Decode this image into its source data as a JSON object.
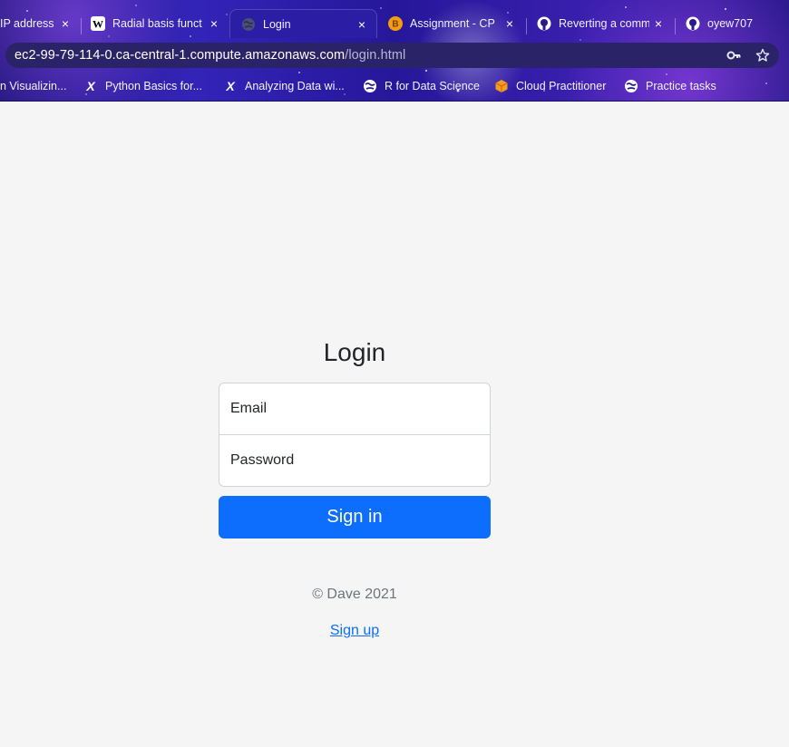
{
  "browser": {
    "tabs": [
      {
        "title": "IP address"
      },
      {
        "title": "Radial basis funct"
      },
      {
        "title": "Login"
      },
      {
        "title": "Assignment - CP"
      },
      {
        "title": "Reverting a comm"
      },
      {
        "title": "oyew707"
      }
    ],
    "close_glyph": "×",
    "url": {
      "host": "ec2-99-79-114-0.ca-central-1.compute.amazonaws.com",
      "path": "/login.html"
    },
    "bookmarks": [
      {
        "label": "n Visualizin..."
      },
      {
        "label": "Python Basics for..."
      },
      {
        "label": "Analyzing Data wi..."
      },
      {
        "label": "R for Data Science"
      },
      {
        "label": "Cloud Practitioner"
      },
      {
        "label": "Practice tasks"
      }
    ],
    "icons": [
      "key-icon",
      "star-icon",
      "wikipedia-icon",
      "globe-icon",
      "github-icon",
      "edx-icon",
      "aws-cube-icon"
    ],
    "colors": {
      "frame": "#2a1b86",
      "active_tab": "#2b1ea5",
      "omnibox": "#2a2368"
    }
  },
  "page": {
    "title": "Login",
    "email_placeholder": "Email",
    "password_placeholder": "Password",
    "signin_label": "Sign in",
    "copyright": "© Dave 2021",
    "signup_label": "Sign up",
    "colors": {
      "background": "#f5f5f5",
      "primary": "#0d6efd",
      "muted": "#6c757d",
      "text": "#212529"
    }
  }
}
